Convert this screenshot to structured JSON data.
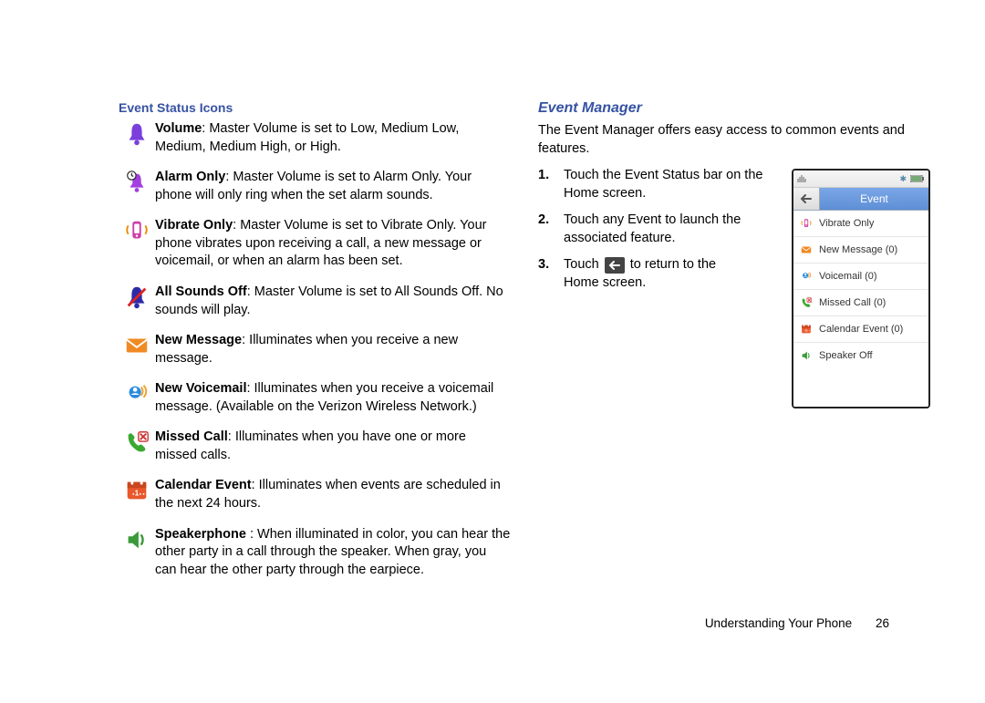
{
  "left": {
    "heading": "Event Status Icons",
    "items": [
      {
        "icon": "volume-bell",
        "title": "Volume",
        "desc": ": Master Volume is set to Low, Medium Low, Medium, Medium High, or High."
      },
      {
        "icon": "alarm-only",
        "title": "Alarm Only",
        "desc": ": Master Volume is set to Alarm Only. Your phone will only ring when the set alarm sounds."
      },
      {
        "icon": "vibrate-only",
        "title": "Vibrate Only",
        "desc": ": Master Volume is set to Vibrate Only. Your phone vibrates upon receiving a call, a new message or voicemail, or when an alarm has been set."
      },
      {
        "icon": "sounds-off",
        "title": "All Sounds Off",
        "desc": ": Master Volume is set to All Sounds Off. No sounds will play."
      },
      {
        "icon": "new-message",
        "title": "New Message",
        "desc": ": Illuminates when you receive a new message."
      },
      {
        "icon": "new-voicemail",
        "title": "New Voicemail",
        "desc": ": Illuminates when you receive a voicemail message. (Available on the Verizon Wireless Network.)"
      },
      {
        "icon": "missed-call",
        "title": "Missed Call",
        "desc": ": Illuminates when you have one or more missed calls."
      },
      {
        "icon": "calendar-event",
        "title": "Calendar Event",
        "desc": ": Illuminates when events are scheduled in the next 24 hours."
      },
      {
        "icon": "speakerphone",
        "title": "Speakerphone",
        "desc": " : When illuminated in color, you can hear the other party in a call through the speaker. When gray, you can hear the other party through the earpiece."
      }
    ]
  },
  "right": {
    "heading": "Event Manager",
    "intro": "The Event Manager offers easy access to common events and features.",
    "steps": {
      "s1": "Touch the Event Status bar on the Home screen.",
      "s2": "Touch any Event to launch the associated feature.",
      "s3a": "Touch ",
      "s3b": " to return to the Home screen."
    }
  },
  "phone": {
    "title": "Event",
    "rows": [
      {
        "icon": "vibrate-only",
        "label": "Vibrate Only"
      },
      {
        "icon": "new-message",
        "label": "New Message (0)"
      },
      {
        "icon": "new-voicemail",
        "label": "Voicemail (0)"
      },
      {
        "icon": "missed-call",
        "label": "Missed Call (0)"
      },
      {
        "icon": "calendar-event",
        "label": "Calendar Event (0)"
      },
      {
        "icon": "speakerphone",
        "label": "Speaker Off"
      }
    ]
  },
  "footer": {
    "section": "Understanding Your Phone",
    "page": "26"
  }
}
